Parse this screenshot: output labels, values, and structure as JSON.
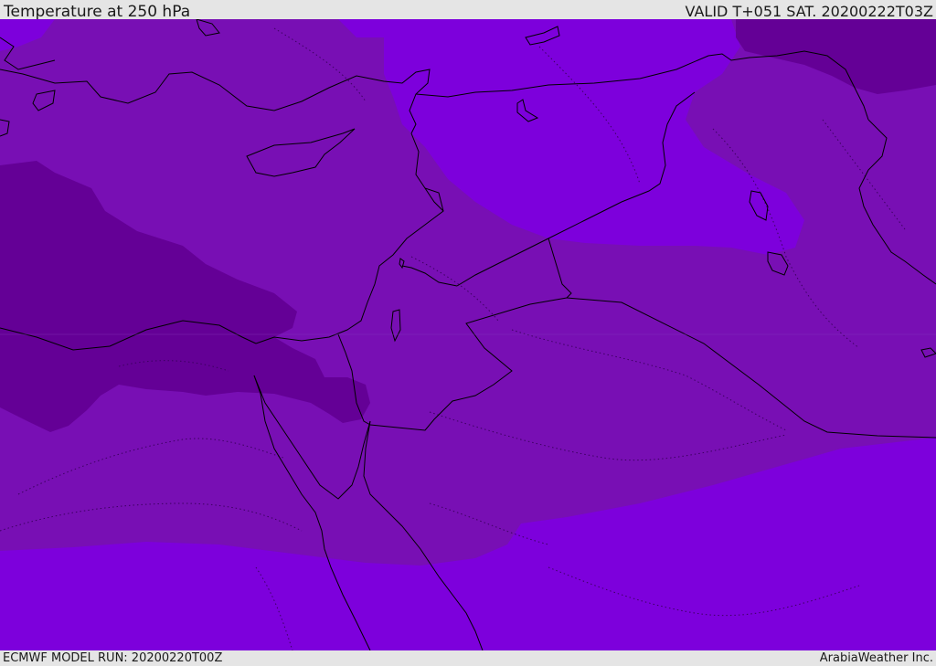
{
  "header": {
    "title": "Temperature at 250 hPa",
    "valid_time": "VALID T+051 SAT. 20200222T03Z"
  },
  "footer": {
    "model_run": "ECMWF MODEL RUN: 20200220T00Z",
    "credit": "ArabiaWeather Inc."
  },
  "colors": {
    "band_coldest": "#640096",
    "band_cold": "#780fb4",
    "band_warm": "#7d00dc",
    "coastline": "#000000",
    "contour": "#3c0060"
  }
}
